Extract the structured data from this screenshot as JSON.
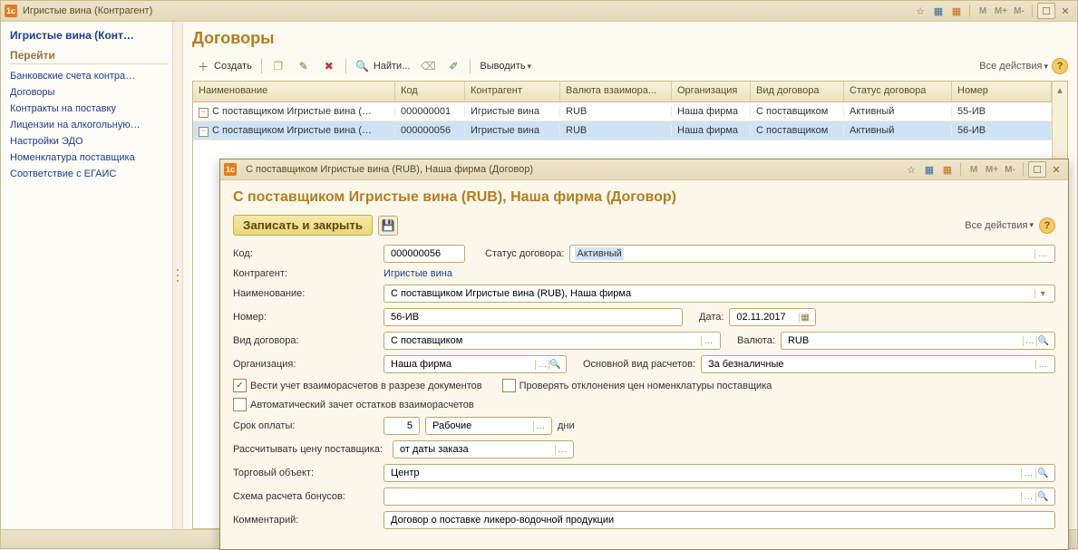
{
  "main": {
    "window_title": "Игристые вина (Контрагент)",
    "titlebar_m": [
      "M",
      "M+",
      "M-"
    ]
  },
  "sidebar": {
    "title": "Игристые вина (Конт…",
    "section": "Перейти",
    "items": [
      "Банковские счета контра…",
      "Договоры",
      "Контракты на поставку",
      "Лицензии на алкогольную…",
      "Настройки ЭДО",
      "Номенклатура поставщика",
      "Соответствие с ЕГАИС"
    ]
  },
  "list": {
    "title": "Договоры",
    "toolbar": {
      "create_label": "Создать",
      "find_label": "Найти...",
      "output_label": "Выводить"
    },
    "all_actions_label": "Все действия",
    "columns": [
      "Наименование",
      "Код",
      "Контрагент",
      "Валюта взаимора...",
      "Организация",
      "Вид договора",
      "Статус договора",
      "Номер"
    ],
    "rows": [
      {
        "name": "С поставщиком Игристые вина (…",
        "code": "000000001",
        "agent": "Игристые вина",
        "cur": "RUB",
        "org": "Наша фирма",
        "type": "С поставщиком",
        "status": "Активный",
        "num": "55-ИВ",
        "sel": false
      },
      {
        "name": "С поставщиком Игристые вина (…",
        "code": "000000056",
        "agent": "Игристые вина",
        "cur": "RUB",
        "org": "Наша фирма",
        "type": "С поставщиком",
        "status": "Активный",
        "num": "56-ИВ",
        "sel": true
      }
    ]
  },
  "dialog": {
    "window_title": "С поставщиком Игристые вина (RUB), Наша фирма (Договор)",
    "form_title": "С поставщиком Игристые вина (RUB), Наша фирма (Договор)",
    "save_close_label": "Записать и закрыть",
    "all_actions_label": "Все действия",
    "labels": {
      "code": "Код:",
      "status": "Статус договора:",
      "agent": "Контрагент:",
      "name": "Наименование:",
      "number": "Номер:",
      "date": "Дата:",
      "type": "Вид договора:",
      "currency": "Валюта:",
      "org": "Организация:",
      "main_calc": "Основной вид расчетов:",
      "cb1": "Вести учет взаиморасчетов в разрезе документов",
      "cb2": "Проверять отклонения цен номенклатуры поставщика",
      "cb3": "Автоматический зачет остатков взаиморасчетов",
      "pay_term": "Срок оплаты:",
      "days": "дни",
      "price_calc": "Рассчитывать цену поставщика:",
      "trade_obj": "Торговый объект:",
      "bonus": "Схема расчета бонусов:",
      "comment": "Комментарий:"
    },
    "values": {
      "code": "000000056",
      "status": "Активный",
      "agent": "Игристые вина",
      "name": "С поставщиком Игристые вина (RUB), Наша фирма",
      "number": "56-ИВ",
      "date": "02.11.2017",
      "type": "С поставщиком",
      "currency": "RUB",
      "org": "Наша фирма",
      "main_calc": "За безналичные",
      "pay_term_qty": "5",
      "pay_term_unit": "Рабочие",
      "price_calc": "от даты заказа",
      "trade_obj": "Центр",
      "bonus": "",
      "comment": "Договор о поставке ликеро-водочной продукции"
    }
  }
}
